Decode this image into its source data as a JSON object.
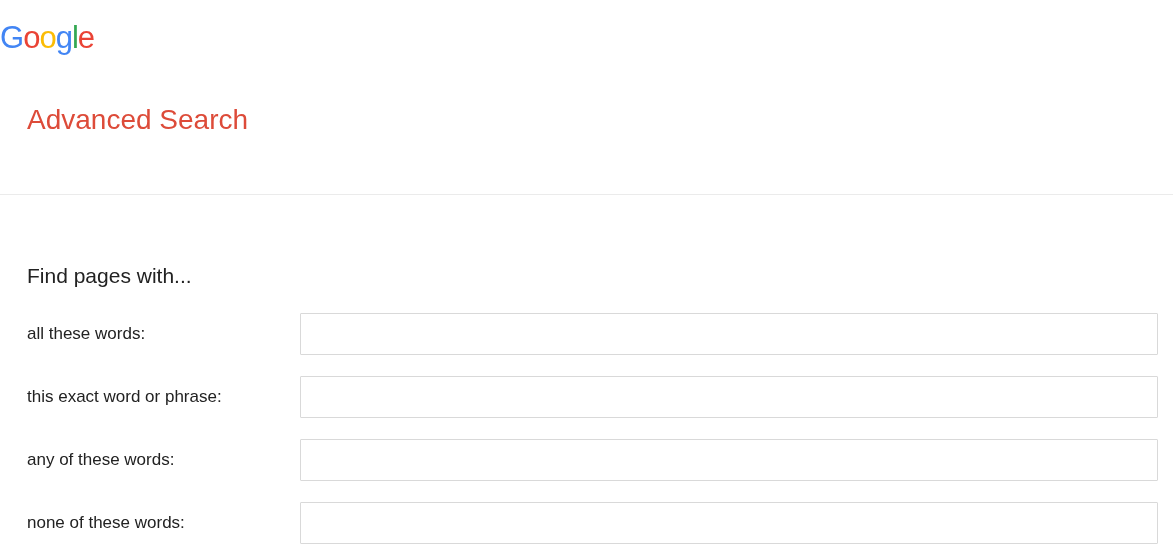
{
  "logo": {
    "letters": [
      {
        "text": "G",
        "color": "#4285f4"
      },
      {
        "text": "o",
        "color": "#ea4335"
      },
      {
        "text": "o",
        "color": "#fbbc05"
      },
      {
        "text": "g",
        "color": "#4285f4"
      },
      {
        "text": "l",
        "color": "#34a853"
      },
      {
        "text": "e",
        "color": "#ea4335"
      }
    ]
  },
  "title": "Advanced Search",
  "section_heading": "Find pages with...",
  "fields": [
    {
      "label": "all these words:"
    },
    {
      "label": "this exact word or phrase:"
    },
    {
      "label": "any of these words:"
    },
    {
      "label": "none of these words:"
    }
  ]
}
